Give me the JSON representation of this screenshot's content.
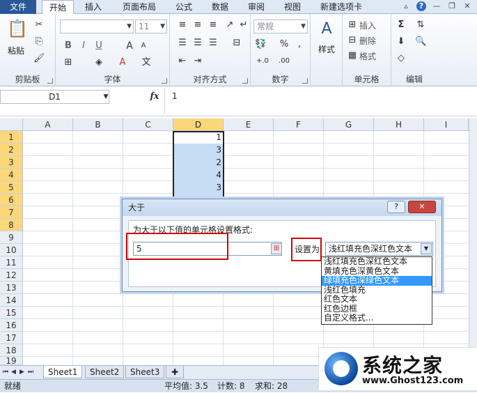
{
  "tabs": {
    "file": "文件",
    "items": [
      "开始",
      "插入",
      "页面布局",
      "公式",
      "数据",
      "审阅",
      "视图",
      "新建选项卡"
    ]
  },
  "ribbon": {
    "clipboard": {
      "paste": "粘贴",
      "label": "剪贴板"
    },
    "font": {
      "size": "11",
      "label": "字体",
      "bold": "B",
      "italic": "I",
      "underline": "U"
    },
    "alignment": {
      "label": "对齐方式"
    },
    "number": {
      "format": "常规",
      "label": "数字",
      "percent": "%",
      "comma": ","
    },
    "styles": {
      "label": "样式"
    },
    "cells": {
      "insert": "插入",
      "delete": "删除",
      "format": "格式",
      "label": "单元格"
    },
    "editing": {
      "label": "编辑"
    }
  },
  "formula_bar": {
    "name": "D1",
    "fx": "fx",
    "value": "1"
  },
  "columns": [
    "A",
    "B",
    "C",
    "D",
    "E",
    "F",
    "G",
    "H",
    "I"
  ],
  "rows": [
    "1",
    "2",
    "3",
    "4",
    "5",
    "6",
    "7",
    "8",
    "9",
    "10",
    "11",
    "12",
    "13",
    "14",
    "15",
    "16",
    "17",
    "18",
    "19"
  ],
  "column_d_values": [
    "1",
    "3",
    "2",
    "4",
    "3"
  ],
  "dialog": {
    "title": "大于",
    "prompt": "为大于以下值的单元格设置格式:",
    "value": "5",
    "set_label": "设置为",
    "selected": "浅红填充色深红色文本",
    "help": "?",
    "close": "✕",
    "options": [
      "浅红填充色深红色文本",
      "黄填充色深黄色文本",
      "绿填充色深绿色文本",
      "浅红色填充",
      "红色文本",
      "红色边框",
      "自定义格式..."
    ]
  },
  "sheets": [
    "Sheet1",
    "Sheet2",
    "Sheet3"
  ],
  "status": {
    "mode": "就绪",
    "average": "平均值: 3.5",
    "count": "计数: 8",
    "sum": "求和: 28"
  },
  "watermark": {
    "title": "系统之家",
    "url": "www.Ghost123.com"
  }
}
